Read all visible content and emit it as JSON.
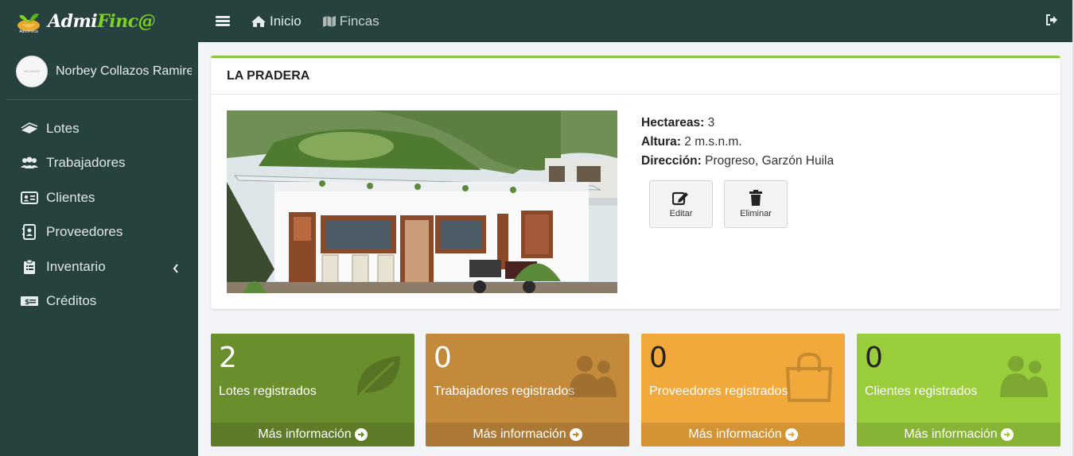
{
  "brand": {
    "name_part1": "Admi",
    "name_part2": "Finc@",
    "logo_caption": "AdmiFinca"
  },
  "user": {
    "name": "Norbey Collazos Ramirez",
    "avatar_text": "NO IMAGE"
  },
  "sidebar": {
    "items": [
      {
        "label": "Lotes",
        "icon": "leaf-stack-icon"
      },
      {
        "label": "Trabajadores",
        "icon": "users-icon"
      },
      {
        "label": "Clientes",
        "icon": "id-card-icon"
      },
      {
        "label": "Proveedores",
        "icon": "contact-book-icon"
      },
      {
        "label": "Inventario",
        "icon": "clipboard-icon"
      },
      {
        "label": "Créditos",
        "icon": "money-icon"
      }
    ]
  },
  "topbar": {
    "inicio": "Inicio",
    "fincas": "Fincas"
  },
  "farm": {
    "title": "LA PRADERA",
    "hectareas_label": "Hectareas:",
    "hectareas_value": "3",
    "altura_label": "Altura:",
    "altura_value": "2 m.s.n.m.",
    "direccion_label": "Dirección:",
    "direccion_value": "Progreso, Garzón Huila",
    "edit_label": "Editar",
    "delete_label": "Eliminar"
  },
  "stats": [
    {
      "count": "2",
      "label": "Lotes registrados",
      "more": "Más información",
      "color": "#6b8e2d"
    },
    {
      "count": "0",
      "label": "Trabajadores registrados",
      "more": "Más información",
      "color": "#c48a3c"
    },
    {
      "count": "0",
      "label": "Proveedores registrados",
      "more": "Más información",
      "color": "#f2a93b"
    },
    {
      "count": "0",
      "label": "Clientes registrados",
      "more": "Más información",
      "color": "#9acd3c"
    }
  ],
  "colors": {
    "sidebar": "#27413f",
    "accent": "#8dc63f"
  }
}
